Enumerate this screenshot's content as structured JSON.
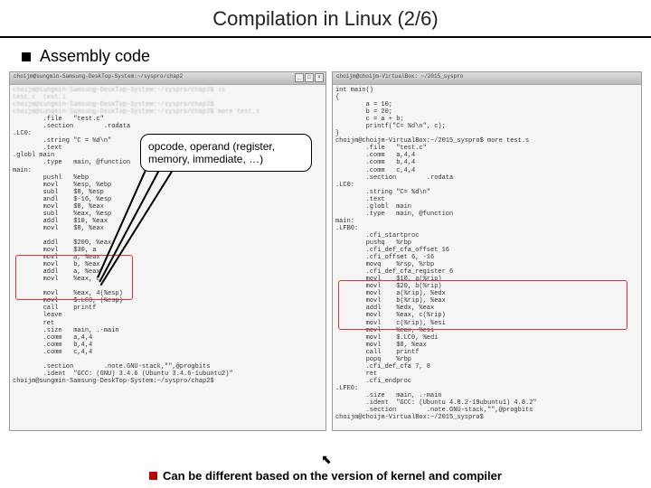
{
  "slide": {
    "title": "Compilation in Linux (2/6)",
    "heading": "Assembly code",
    "footer": "Can be different based on the version of kernel and compiler"
  },
  "callout": {
    "line1": "opcode, operand (register,",
    "line2": "memory, immediate, …)"
  },
  "left_panel": {
    "titlebar": "choijm@sungmin-Samsung-DeskTop-System:~/syspro/chap2",
    "prompt1": "choijm@sungmin-Samsung-DeskTop-System:~/syspro/chap2$ ls",
    "prompt2": "test.c  test.i",
    "prompt3": "choijm@sungmin-Samsung-DeskTop-System:~/syspro/chap2$",
    "prompt4": "choijm@sungmin-Samsung-DeskTop-System:~/syspro/chap2$ more test.s",
    "code": "        .file   \"test.c\"\n        .section        .rodata\n.LC0:\n        .string \"C = %d\\n\"\n        .text\n.globl main\n        .type   main, @function\nmain:\n        pushl   %ebp\n        movl    %esp, %ebp\n        subl    $8, %esp\n        andl    $-16, %esp\n        movl    $0, %eax\n        subl    %eax, %esp\n        addl    $10, %eax\n        movl    $8, %eax\n\n        addl    $200, %eax\n        movl    $30, a\n        movl    a, %eax\n        movl    b, %eax\n        addl    a, %eax\n        movl    %eax, c\n\n        movl    %eax, 4(%esp)\n        movl    $.LC0, (%esp)\n        call    printf\n        leave\n        ret\n        .size   main, .-main\n        .comm   a,4,4\n        .comm   b,4,4\n        .comm   c,4,4\n\n        .section        .note.GNU-stack,\"\",@progbits\n        .ident  \"GCC: (GNU) 3.4.6 (Ubuntu 3.4.6-1ubuntu2)\"\nchoijm@sungmin-Samsung-DeskTop-System:~/syspro/chap2$"
  },
  "right_panel": {
    "titlebar": "choijm@choijm-VirtualBox: ~/2015_syspro",
    "header": "int main()\n{\n        a = 10;\n        b = 20;\n        c = a + b;\n        printf(\"C= %d\\n\", c);\n}\nchoijm@choijm-VirtualBox:~/2015_syspro$ more test.s",
    "code": "        .file   \"test.c\"\n        .comm   a,4,4\n        .comm   b,4,4\n        .comm   c,4,4\n        .section        .rodata\n.LC0:\n        .string \"C= %d\\n\"\n        .text\n        .globl  main\n        .type   main, @function\nmain:\n.LFB0:\n        .cfi_startproc\n        pushq   %rbp\n        .cfi_def_cfa_offset 16\n        .cfi_offset 6, -16\n        movq    %rsp, %rbp\n        .cfi_def_cfa_register 6\n        movl    $10, a(%rip)\n        movl    $20, b(%rip)\n        movl    a(%rip), %edx\n        movl    b(%rip), %eax\n        addl    %edx, %eax\n        movl    %eax, c(%rip)\n        movl    c(%rip), %esi\n        movl    %eax, %esi\n        movl    $.LC0, %edi\n        movl    $0, %eax\n        call    printf\n        popq    %rbp\n        .cfi_def_cfa 7, 8\n        ret\n        .cfi_endproc\n.LFE0:\n        .size   main, .-main\n        .ident  \"GCC: (Ubuntu 4.8.2-19ubuntu1) 4.8.2\"\n        .section        .note.GNU-stack,\"\",@progbits\nchoijm@choijm-VirtualBox:~/2015_syspro$"
  }
}
